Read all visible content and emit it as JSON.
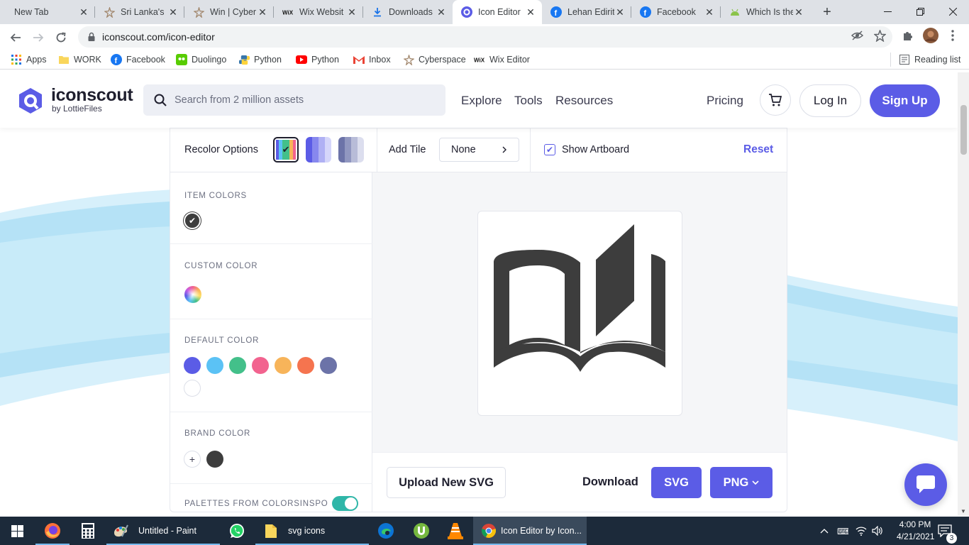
{
  "browser": {
    "tabs": [
      {
        "title": "New Tab",
        "icon": "none"
      },
      {
        "title": "Sri Lanka's",
        "icon": "star-logo-icon"
      },
      {
        "title": "Win | Cyber",
        "icon": "star-logo-icon"
      },
      {
        "title": "Wix Websit",
        "icon": "wix-icon"
      },
      {
        "title": "Downloads",
        "icon": "download-icon"
      },
      {
        "title": "Icon Editor",
        "icon": "iconscout-icon"
      },
      {
        "title": "Lehan Edirit",
        "icon": "facebook-icon"
      },
      {
        "title": "Facebook",
        "icon": "facebook-icon"
      },
      {
        "title": "Which Is the",
        "icon": "android-icon"
      }
    ],
    "tab_close_glyph": "✕",
    "new_tab_glyph": "+",
    "url": "iconscout.com/icon-editor",
    "bookmarks": [
      {
        "label": "Apps",
        "icon": "apps-grid-icon"
      },
      {
        "label": "WORK",
        "icon": "folder-icon"
      },
      {
        "label": "Facebook",
        "icon": "facebook-icon"
      },
      {
        "label": "Duolingo",
        "icon": "duolingo-icon"
      },
      {
        "label": "Python",
        "icon": "python-icon"
      },
      {
        "label": "Python",
        "icon": "youtube-icon"
      },
      {
        "label": "Inbox",
        "icon": "gmail-icon"
      },
      {
        "label": "Cyberspace",
        "icon": "star-logo-icon"
      },
      {
        "label": "Wix Editor",
        "icon": "wix-icon"
      }
    ],
    "reading_list": "Reading list"
  },
  "site": {
    "logo_name": "iconscout",
    "logo_sub": "by LottieFiles",
    "search_placeholder": "Search from 2 million assets",
    "nav": [
      "Explore",
      "Tools",
      "Resources"
    ],
    "pricing": "Pricing",
    "login": "Log In",
    "signup": "Sign Up"
  },
  "editor": {
    "recolor_label": "Recolor Options",
    "add_tile_label": "Add Tile",
    "tile_value": "None",
    "show_artboard_label": "Show Artboard",
    "show_artboard_checked": true,
    "reset_label": "Reset",
    "sections": {
      "item_colors": "ITEM COLORS",
      "custom_color": "CUSTOM COLOR",
      "default_color": "DEFAULT COLOR",
      "brand_color": "BRAND COLOR",
      "palettes": "PALETTES FROM COLORSINSPO"
    },
    "item_colors": [
      "#3d3d3d"
    ],
    "default_colors": [
      "#5b5ce6",
      "#5bc2f5",
      "#43c08a",
      "#f2638f",
      "#f7b45a",
      "#f5744f",
      "#6c73a8",
      "#ffffff"
    ],
    "brand_colors": [
      "#3d3d3d"
    ],
    "palettes_toggle_on": true,
    "upload_label": "Upload New SVG",
    "download_label": "Download",
    "svg_label": "SVG",
    "png_label": "PNG"
  },
  "taskbar": {
    "items": [
      {
        "label": "",
        "icon": "windows-start-icon"
      },
      {
        "label": "",
        "icon": "firefox-icon"
      },
      {
        "label": "",
        "icon": "calculator-icon"
      },
      {
        "label": "Untitled - Paint",
        "icon": "paint-icon"
      },
      {
        "label": "",
        "icon": "whatsapp-icon"
      },
      {
        "label": "svg icons",
        "icon": "file-explorer-icon"
      },
      {
        "label": "",
        "icon": "edge-icon"
      },
      {
        "label": "",
        "icon": "utorrent-icon"
      },
      {
        "label": "",
        "icon": "vlc-icon"
      },
      {
        "label": "Icon Editor by Icon...",
        "icon": "chrome-icon"
      }
    ],
    "time": "4:00 PM",
    "date": "4/21/2021",
    "notification_count": "3"
  },
  "colors": {
    "accent": "#5b5ce6",
    "icon_fill": "#3d3d3d",
    "toggle": "#2fb6a8",
    "wave": "#bde6f7"
  }
}
